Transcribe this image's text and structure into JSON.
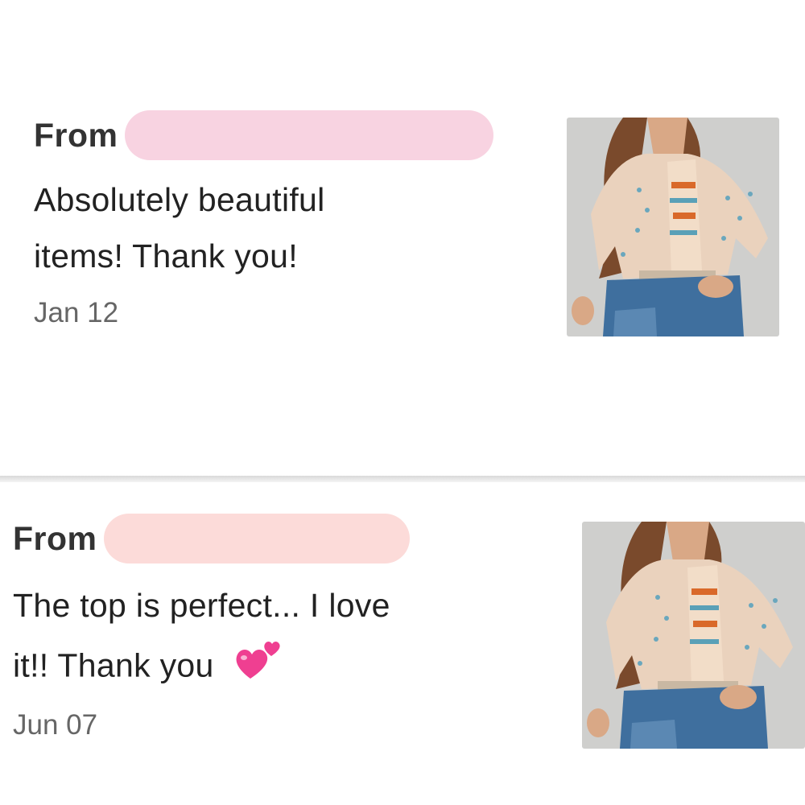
{
  "colors": {
    "redaction_1": "#f8d3e1",
    "redaction_2": "#fcdbd9",
    "heart": "#ef3f91",
    "backdrop": "#cfcfcd",
    "denim": "#3f6f9e",
    "blouse": "#ead2bd",
    "hair": "#7a4a2c"
  },
  "reviews": [
    {
      "from_label": "From",
      "text_line1": "Absolutely beautiful",
      "text_line2": "items! Thank you!",
      "date": "Jan 12",
      "emoji": ""
    },
    {
      "from_label": "From",
      "text_line1": "The top is perfect... I love",
      "text_line2": "it!! Thank you",
      "date": "Jun 07",
      "emoji": "two-hearts-icon"
    }
  ]
}
